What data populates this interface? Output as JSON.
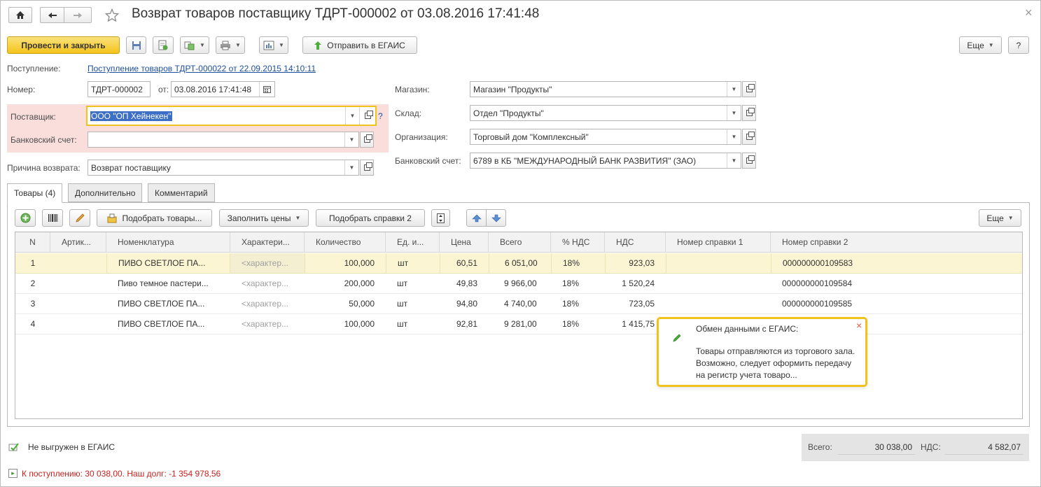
{
  "window": {
    "title": "Возврат товаров поставщику ТДРТ-000002 от 03.08.2016 17:41:48",
    "close_symbol": "×"
  },
  "toolbar": {
    "post_and_close": "Провести и закрыть",
    "send_egais": "Отправить в ЕГАИС",
    "more": "Еще",
    "help": "?"
  },
  "header": {
    "receipt_label": "Поступление:",
    "receipt_link": "Поступление товаров ТДРТ-000022 от 22.09.2015 14:10:11",
    "number_label": "Номер:",
    "number_value": "ТДРТ-000002",
    "from_label": "от:",
    "date_value": "03.08.2016 17:41:48",
    "supplier_label": "Поставщик:",
    "supplier_value": "ООО \"ОП Хейнекен\"",
    "supplier_hint": "?",
    "bank_label": "Банковский счет:",
    "bank_value": "",
    "reason_label": "Причина возврата:",
    "reason_value": "Возврат поставщику",
    "store_label": "Магазин:",
    "store_value": "Магазин \"Продукты\"",
    "warehouse_label": "Склад:",
    "warehouse_value": "Отдел \"Продукты\"",
    "org_label": "Организация:",
    "org_value": "Торговый дом \"Комплексный\"",
    "org_bank_label": "Банковский счет:",
    "org_bank_value": "6789 в КБ \"МЕЖДУНАРОДНЫЙ БАНК РАЗВИТИЯ\" (ЗАО)"
  },
  "tabs": [
    {
      "label": "Товары (4)"
    },
    {
      "label": "Дополнительно"
    },
    {
      "label": "Комментарий"
    }
  ],
  "table_toolbar": {
    "pick_goods": "Подобрать товары...",
    "fill_prices": "Заполнить цены",
    "pick_certs": "Подобрать справки 2",
    "more": "Еще"
  },
  "table": {
    "columns": [
      "N",
      "Артик...",
      "Номенклатура",
      "Характери...",
      "Количество",
      "Ед. и...",
      "Цена",
      "Всего",
      "% НДС",
      "НДС",
      "Номер справки 1",
      "Номер справки 2"
    ],
    "rows": [
      [
        "1",
        "",
        "ПИВО СВЕТЛОЕ ПА...",
        "<характер...",
        "100,000",
        "шт",
        "60,51",
        "6 051,00",
        "18%",
        "923,03",
        "",
        "000000000109583"
      ],
      [
        "2",
        "",
        "Пиво темное пастери...",
        "<характер...",
        "200,000",
        "шт",
        "49,83",
        "9 966,00",
        "18%",
        "1 520,24",
        "",
        "000000000109584"
      ],
      [
        "3",
        "",
        "ПИВО СВЕТЛОЕ ПА...",
        "<характер...",
        "50,000",
        "шт",
        "94,80",
        "4 740,00",
        "18%",
        "723,05",
        "",
        "000000000109585"
      ],
      [
        "4",
        "",
        "ПИВО СВЕТЛОЕ ПА...",
        "<характер...",
        "100,000",
        "шт",
        "92,81",
        "9 281,00",
        "18%",
        "1 415,75",
        "",
        "000000000109586"
      ]
    ]
  },
  "notification": {
    "title": "Обмен данными с ЕГАИС:",
    "text": "Товары отправляются из торгового зала. Возможно, следует оформить передачу на регистр учета товаро...",
    "close": "×"
  },
  "footer": {
    "egais_status": "Не выгружен в ЕГАИС",
    "debt_text": "К поступлению: 30 038,00. Наш долг: -1 354 978,56",
    "total_label": "Всего:",
    "total_value": "30 038,00",
    "vat_label": "НДС:",
    "vat_value": "4 582,07"
  },
  "colors": {
    "accent_yellow": "#f3c31b",
    "selected_row": "#fbf5d3",
    "error_bg": "#f9dedc",
    "link": "#1d4f9b",
    "debt_text": "#c8211d"
  }
}
